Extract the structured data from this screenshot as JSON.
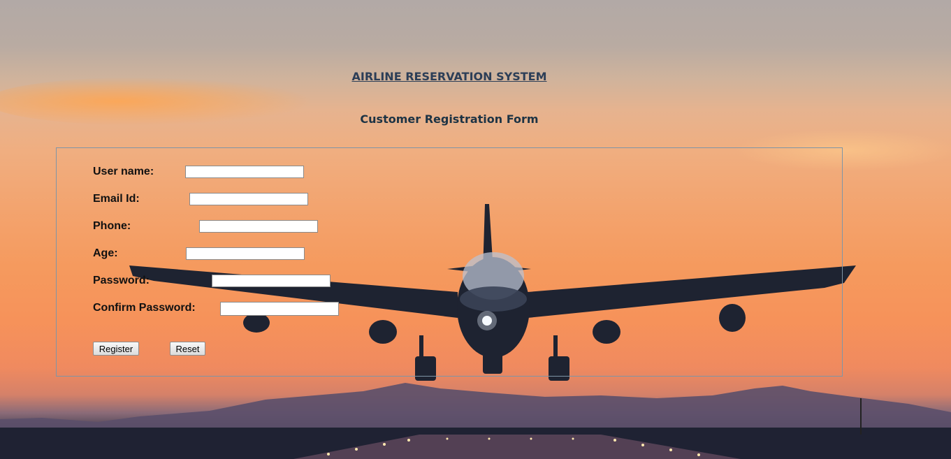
{
  "header": {
    "system_title": "AIRLINE RESERVATION SYSTEM",
    "form_title": "Customer Registration Form"
  },
  "form": {
    "fields": [
      {
        "label": "User name:",
        "value": ""
      },
      {
        "label": "Email Id:",
        "value": ""
      },
      {
        "label": "Phone:",
        "value": ""
      },
      {
        "label": "Age:",
        "value": ""
      },
      {
        "label": "Password:",
        "value": ""
      },
      {
        "label": "Confirm Password:",
        "value": ""
      }
    ],
    "register_label": "Register",
    "reset_label": "Reset"
  }
}
